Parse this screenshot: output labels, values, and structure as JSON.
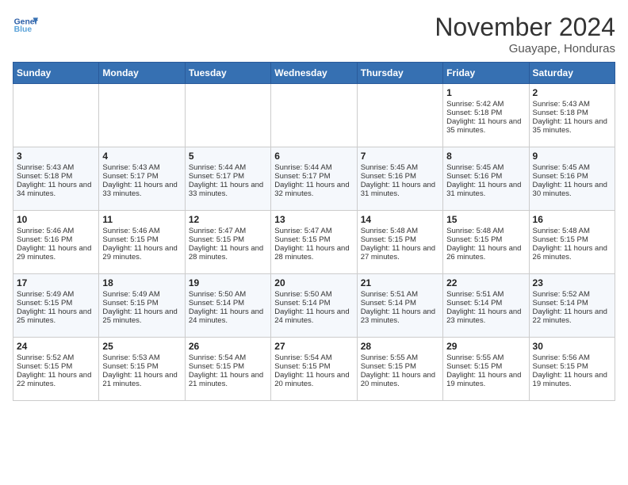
{
  "header": {
    "logo_line1": "General",
    "logo_line2": "Blue",
    "month": "November 2024",
    "location": "Guayape, Honduras"
  },
  "weekdays": [
    "Sunday",
    "Monday",
    "Tuesday",
    "Wednesday",
    "Thursday",
    "Friday",
    "Saturday"
  ],
  "weeks": [
    [
      {
        "day": "",
        "info": ""
      },
      {
        "day": "",
        "info": ""
      },
      {
        "day": "",
        "info": ""
      },
      {
        "day": "",
        "info": ""
      },
      {
        "day": "",
        "info": ""
      },
      {
        "day": "1",
        "info": "Sunrise: 5:42 AM\nSunset: 5:18 PM\nDaylight: 11 hours and 35 minutes."
      },
      {
        "day": "2",
        "info": "Sunrise: 5:43 AM\nSunset: 5:18 PM\nDaylight: 11 hours and 35 minutes."
      }
    ],
    [
      {
        "day": "3",
        "info": "Sunrise: 5:43 AM\nSunset: 5:18 PM\nDaylight: 11 hours and 34 minutes."
      },
      {
        "day": "4",
        "info": "Sunrise: 5:43 AM\nSunset: 5:17 PM\nDaylight: 11 hours and 33 minutes."
      },
      {
        "day": "5",
        "info": "Sunrise: 5:44 AM\nSunset: 5:17 PM\nDaylight: 11 hours and 33 minutes."
      },
      {
        "day": "6",
        "info": "Sunrise: 5:44 AM\nSunset: 5:17 PM\nDaylight: 11 hours and 32 minutes."
      },
      {
        "day": "7",
        "info": "Sunrise: 5:45 AM\nSunset: 5:16 PM\nDaylight: 11 hours and 31 minutes."
      },
      {
        "day": "8",
        "info": "Sunrise: 5:45 AM\nSunset: 5:16 PM\nDaylight: 11 hours and 31 minutes."
      },
      {
        "day": "9",
        "info": "Sunrise: 5:45 AM\nSunset: 5:16 PM\nDaylight: 11 hours and 30 minutes."
      }
    ],
    [
      {
        "day": "10",
        "info": "Sunrise: 5:46 AM\nSunset: 5:16 PM\nDaylight: 11 hours and 29 minutes."
      },
      {
        "day": "11",
        "info": "Sunrise: 5:46 AM\nSunset: 5:15 PM\nDaylight: 11 hours and 29 minutes."
      },
      {
        "day": "12",
        "info": "Sunrise: 5:47 AM\nSunset: 5:15 PM\nDaylight: 11 hours and 28 minutes."
      },
      {
        "day": "13",
        "info": "Sunrise: 5:47 AM\nSunset: 5:15 PM\nDaylight: 11 hours and 28 minutes."
      },
      {
        "day": "14",
        "info": "Sunrise: 5:48 AM\nSunset: 5:15 PM\nDaylight: 11 hours and 27 minutes."
      },
      {
        "day": "15",
        "info": "Sunrise: 5:48 AM\nSunset: 5:15 PM\nDaylight: 11 hours and 26 minutes."
      },
      {
        "day": "16",
        "info": "Sunrise: 5:48 AM\nSunset: 5:15 PM\nDaylight: 11 hours and 26 minutes."
      }
    ],
    [
      {
        "day": "17",
        "info": "Sunrise: 5:49 AM\nSunset: 5:15 PM\nDaylight: 11 hours and 25 minutes."
      },
      {
        "day": "18",
        "info": "Sunrise: 5:49 AM\nSunset: 5:15 PM\nDaylight: 11 hours and 25 minutes."
      },
      {
        "day": "19",
        "info": "Sunrise: 5:50 AM\nSunset: 5:14 PM\nDaylight: 11 hours and 24 minutes."
      },
      {
        "day": "20",
        "info": "Sunrise: 5:50 AM\nSunset: 5:14 PM\nDaylight: 11 hours and 24 minutes."
      },
      {
        "day": "21",
        "info": "Sunrise: 5:51 AM\nSunset: 5:14 PM\nDaylight: 11 hours and 23 minutes."
      },
      {
        "day": "22",
        "info": "Sunrise: 5:51 AM\nSunset: 5:14 PM\nDaylight: 11 hours and 23 minutes."
      },
      {
        "day": "23",
        "info": "Sunrise: 5:52 AM\nSunset: 5:14 PM\nDaylight: 11 hours and 22 minutes."
      }
    ],
    [
      {
        "day": "24",
        "info": "Sunrise: 5:52 AM\nSunset: 5:15 PM\nDaylight: 11 hours and 22 minutes."
      },
      {
        "day": "25",
        "info": "Sunrise: 5:53 AM\nSunset: 5:15 PM\nDaylight: 11 hours and 21 minutes."
      },
      {
        "day": "26",
        "info": "Sunrise: 5:54 AM\nSunset: 5:15 PM\nDaylight: 11 hours and 21 minutes."
      },
      {
        "day": "27",
        "info": "Sunrise: 5:54 AM\nSunset: 5:15 PM\nDaylight: 11 hours and 20 minutes."
      },
      {
        "day": "28",
        "info": "Sunrise: 5:55 AM\nSunset: 5:15 PM\nDaylight: 11 hours and 20 minutes."
      },
      {
        "day": "29",
        "info": "Sunrise: 5:55 AM\nSunset: 5:15 PM\nDaylight: 11 hours and 19 minutes."
      },
      {
        "day": "30",
        "info": "Sunrise: 5:56 AM\nSunset: 5:15 PM\nDaylight: 11 hours and 19 minutes."
      }
    ]
  ]
}
